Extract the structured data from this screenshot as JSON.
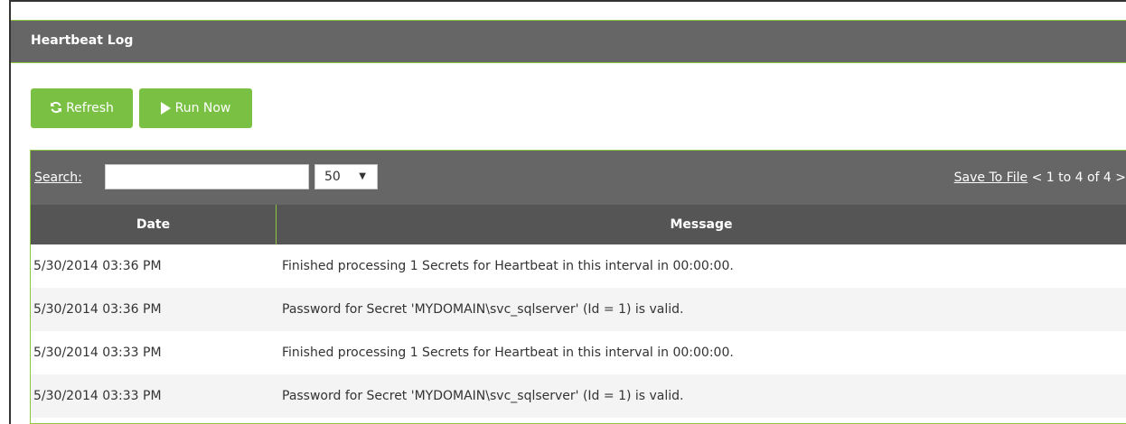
{
  "panel": {
    "title": "Heartbeat Log"
  },
  "actions": {
    "refresh_label": "Refresh",
    "run_now_label": "Run Now"
  },
  "toolbar": {
    "search_label": "Search:",
    "search_value": "",
    "page_size": "50",
    "save_to_file": "Save To File",
    "pager_text": "< 1 to 4 of 4 >"
  },
  "table": {
    "columns": [
      "Date",
      "Message"
    ],
    "rows": [
      {
        "date": "5/30/2014 03:36 PM",
        "message": "Finished processing 1 Secrets for Heartbeat in this interval in 00:00:00."
      },
      {
        "date": "5/30/2014 03:36 PM",
        "message": "Password for Secret 'MYDOMAIN\\svc_sqlserver' (Id = 1) is valid."
      },
      {
        "date": "5/30/2014 03:33 PM",
        "message": "Finished processing 1 Secrets for Heartbeat in this interval in 00:00:00."
      },
      {
        "date": "5/30/2014 03:33 PM",
        "message": "Password for Secret 'MYDOMAIN\\svc_sqlserver' (Id = 1) is valid."
      }
    ]
  },
  "colors": {
    "accent": "#7ac143",
    "header_bg": "#666666",
    "column_header_bg": "#555555",
    "alt_row_bg": "#f4f4f4"
  },
  "icons": {
    "refresh": "refresh-icon",
    "run": "play-icon",
    "dropdown": "chevron-down-icon"
  }
}
